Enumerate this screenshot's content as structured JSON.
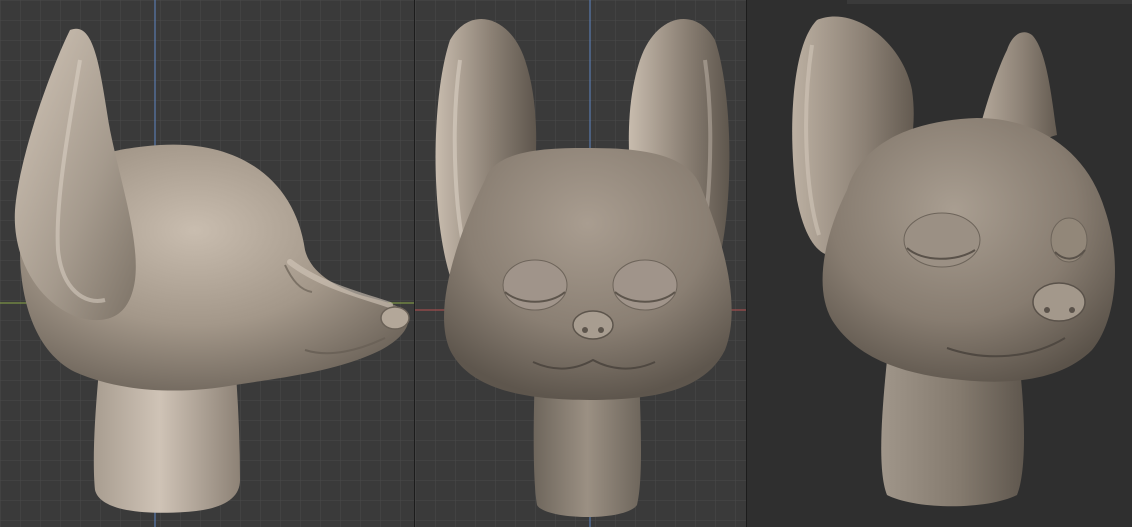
{
  "views": [
    {
      "id": "side",
      "view": "side"
    },
    {
      "id": "front",
      "view": "front"
    },
    {
      "id": "three-quarter",
      "view": "three-quarter"
    }
  ],
  "colors": {
    "viewport_bg": "#3a3a3a",
    "viewport_bg_alt": "#2f2f2f",
    "grid_line": "#4a4a4a",
    "axis_x": "#8aa845",
    "axis_y": "#5f86c4",
    "axis_red": "#b55050",
    "clay_light": "#cbbfb1",
    "clay_mid": "#9a8f82",
    "clay_dark": "#5c544b"
  },
  "icons": [
    "grid-icon"
  ]
}
